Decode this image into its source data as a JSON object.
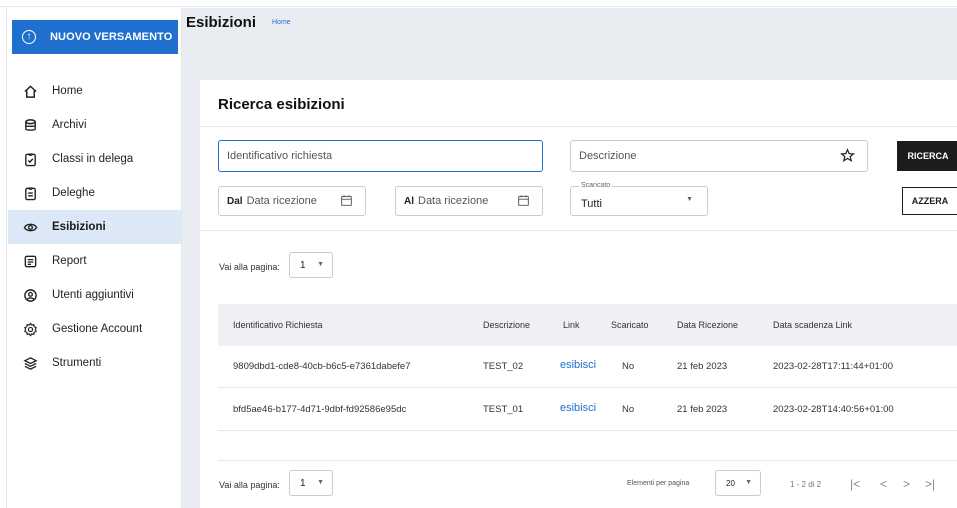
{
  "sidebar": {
    "new_button": "NUOVO VERSAMENTO",
    "items": [
      {
        "label": "Home",
        "icon": "home-icon"
      },
      {
        "label": "Archivi",
        "icon": "database-icon"
      },
      {
        "label": "Classi in delega",
        "icon": "clipboard-check-icon"
      },
      {
        "label": "Deleghe",
        "icon": "clipboard-list-icon"
      },
      {
        "label": "Esibizioni",
        "icon": "eye-icon",
        "active": true
      },
      {
        "label": "Report",
        "icon": "report-icon"
      },
      {
        "label": "Utenti aggiuntivi",
        "icon": "user-circle-icon"
      },
      {
        "label": "Gestione Account",
        "icon": "gear-icon"
      },
      {
        "label": "Strumenti",
        "icon": "layers-icon"
      }
    ]
  },
  "header": {
    "title": "Esibizioni",
    "breadcrumb": "Home"
  },
  "search": {
    "title": "Ricerca esibizioni",
    "id_placeholder": "Identificativo richiesta",
    "desc_placeholder": "Descrizione",
    "search_button": "RICERCA",
    "reset_button": "AZZERA",
    "from_prefix": "Dal",
    "from_placeholder": "Data ricezione",
    "to_prefix": "Al",
    "to_placeholder": "Data ricezione",
    "downloaded_label": "Scaricato",
    "downloaded_value": "Tutti"
  },
  "pager_top": {
    "goto_label": "Vai alla pagina:",
    "page": "1"
  },
  "table": {
    "columns": [
      "Identificativo Richiesta",
      "Descrizione",
      "Link",
      "Scaricato",
      "Data Ricezione",
      "Data scadenza Link"
    ],
    "rows": [
      [
        "9809dbd1-cde8-40cb-b6c5-e7361dabefe7",
        "TEST_02",
        "esibisci",
        "No",
        "21 feb 2023",
        "2023-02-28T17:11:44+01:00"
      ],
      [
        "bfd5ae46-b177-4d71-9dbf-fd92586e95dc",
        "TEST_01",
        "esibisci",
        "No",
        "21 feb 2023",
        "2023-02-28T14:40:56+01:00"
      ]
    ]
  },
  "pager_bottom": {
    "goto_label": "Vai alla pagina:",
    "page": "1",
    "per_page_label": "Elementi per pagina",
    "per_page": "20",
    "range": "1 - 2 di 2"
  },
  "colors": {
    "primary": "#1f6fcf",
    "active_bg": "#dde8f7",
    "dark_button": "#1c1c1c",
    "page_bg": "#e9edf2"
  }
}
